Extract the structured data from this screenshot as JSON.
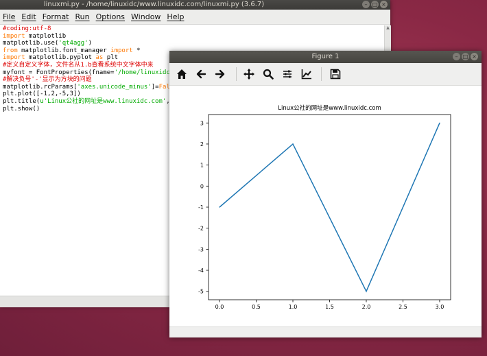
{
  "idle_window": {
    "title": "linuxmi.py - /home/linuxidc/www.linuxidc.com/linuxmi.py (3.6.7)",
    "menu": [
      "File",
      "Edit",
      "Format",
      "Run",
      "Options",
      "Window",
      "Help"
    ],
    "code_lines": [
      [
        {
          "t": "#coding:utf-8",
          "c": "comment"
        }
      ],
      [
        {
          "t": "import",
          "c": "kw"
        },
        {
          "t": " matplotlib",
          "c": ""
        }
      ],
      [
        {
          "t": "matplotlib.use(",
          "c": ""
        },
        {
          "t": "'qt4agg'",
          "c": "str"
        },
        {
          "t": ")",
          "c": ""
        }
      ],
      [
        {
          "t": "from",
          "c": "kw"
        },
        {
          "t": " matplotlib.font_manager ",
          "c": ""
        },
        {
          "t": "import",
          "c": "kw"
        },
        {
          "t": " *",
          "c": ""
        }
      ],
      [
        {
          "t": "import",
          "c": "kw"
        },
        {
          "t": " matplotlib.pyplot ",
          "c": ""
        },
        {
          "t": "as",
          "c": "kw"
        },
        {
          "t": " plt",
          "c": ""
        }
      ],
      [
        {
          "t": "#定义自定义字体，文件名从1.b查看系统中文字体中来",
          "c": "comment"
        }
      ],
      [
        {
          "t": "myfont = FontProperties(fname=",
          "c": ""
        },
        {
          "t": "'/home/linuxidc/",
          "c": "str"
        }
      ],
      [
        {
          "t": "#解决负号'-'显示为方块的问题",
          "c": "comment"
        }
      ],
      [
        {
          "t": "matplotlib.rcParams[",
          "c": ""
        },
        {
          "t": "'axes.unicode_minus'",
          "c": "str"
        },
        {
          "t": "]=",
          "c": ""
        },
        {
          "t": "False",
          "c": "kw"
        }
      ],
      [
        {
          "t": "plt.plot([-1,2,-5,3])",
          "c": ""
        }
      ],
      [
        {
          "t": "plt.title(",
          "c": ""
        },
        {
          "t": "u'Linux公社的网址是www.linuxidc.com'",
          "c": "str"
        },
        {
          "t": ",fo",
          "c": ""
        }
      ],
      [
        {
          "t": "plt.show()",
          "c": ""
        }
      ]
    ]
  },
  "figure_window": {
    "title": "Figure 1",
    "toolbar": [
      "home-icon",
      "back-arrow-icon",
      "forward-arrow-icon",
      "pan-icon",
      "zoom-icon",
      "subplots-icon",
      "edit-axis-icon",
      "save-icon"
    ]
  },
  "chart_data": {
    "type": "line",
    "title": "Linux公社的网址是www.linuxidc.com",
    "x": [
      0,
      1,
      2,
      3
    ],
    "series": [
      {
        "values": [
          -1,
          2,
          -5,
          3
        ],
        "color": "#1f77b4"
      }
    ],
    "xlim": [
      -0.15,
      3.15
    ],
    "ylim": [
      -5.4,
      3.4
    ],
    "xticks": [
      0.0,
      0.5,
      1.0,
      1.5,
      2.0,
      2.5,
      3.0
    ],
    "xtick_labels": [
      "0.0",
      "0.5",
      "1.0",
      "1.5",
      "2.0",
      "2.5",
      "3.0"
    ],
    "yticks": [
      3,
      2,
      1,
      0,
      -1,
      -2,
      -3,
      -4,
      -5
    ],
    "ytick_labels": [
      "3",
      "2",
      "1",
      "0",
      "-1",
      "-2",
      "-3",
      "-4",
      "-5"
    ],
    "grid": false,
    "xlabel": "",
    "ylabel": ""
  }
}
